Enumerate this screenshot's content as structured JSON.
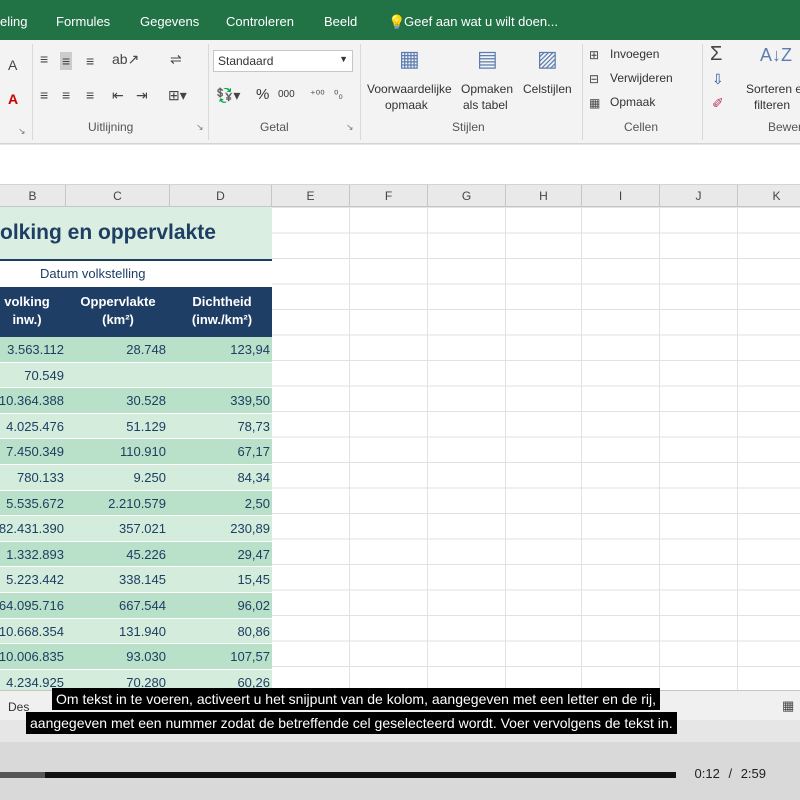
{
  "ribbon": {
    "tabs": [
      "eling",
      "Formules",
      "Gegevens",
      "Controleren",
      "Beeld"
    ],
    "tell_me": "Geef aan wat u wilt doen...",
    "number_format": "Standaard",
    "currency_symbol": "%",
    "thousands": "000",
    "buttons": {
      "conditional_l1": "Voorwaardelijke",
      "conditional_l2": "opmaak",
      "format_table_l1": "Opmaken",
      "format_table_l2": "als tabel",
      "cell_styles": "Celstijlen",
      "insert": "Invoegen",
      "delete": "Verwijderen",
      "format": "Opmaak",
      "sort_l1": "Sorteren e",
      "sort_l2": "filteren"
    },
    "groups": {
      "alignment": "Uitlijning",
      "number": "Getal",
      "styles": "Stijlen",
      "cells": "Cellen",
      "editing": "Bewer"
    }
  },
  "columns": [
    "B",
    "C",
    "D",
    "E",
    "F",
    "G",
    "H",
    "I",
    "J",
    "K"
  ],
  "table": {
    "title": "olking en oppervlakte",
    "date_label": "Datum volkstelling",
    "headers": [
      "volking\ninw.)",
      "Oppervlakte\n(km²)",
      "Dichtheid\n(inw./km²)"
    ],
    "rows": [
      [
        "3.563.112",
        "28.748",
        "123,94"
      ],
      [
        "70.549",
        "",
        ""
      ],
      [
        "10.364.388",
        "30.528",
        "339,50"
      ],
      [
        "4.025.476",
        "51.129",
        "78,73"
      ],
      [
        "7.450.349",
        "110.910",
        "67,17"
      ],
      [
        "780.133",
        "9.250",
        "84,34"
      ],
      [
        "5.535.672",
        "2.210.579",
        "2,50"
      ],
      [
        "82.431.390",
        "357.021",
        "230,89"
      ],
      [
        "1.332.893",
        "45.226",
        "29,47"
      ],
      [
        "5.223.442",
        "338.145",
        "15,45"
      ],
      [
        "64.095.716",
        "667.544",
        "96,02"
      ],
      [
        "10.668.354",
        "131.940",
        "80,86"
      ],
      [
        "10.006.835",
        "93.030",
        "107,57"
      ],
      [
        "4.234.925",
        "70.280",
        "60,26"
      ]
    ]
  },
  "sheet_tab": "Des",
  "subtitles": {
    "line1": "Om tekst in te voeren, activeert u het snijpunt van de kolom, aangegeven met een letter en de rij,",
    "line2": "aangegeven met een nummer zodat de betreffende cel geselecteerd wordt. Voer vervolgens de tekst in."
  },
  "player": {
    "current": "0:12",
    "separator": "/",
    "total": "2:59",
    "progress": 0.067
  }
}
